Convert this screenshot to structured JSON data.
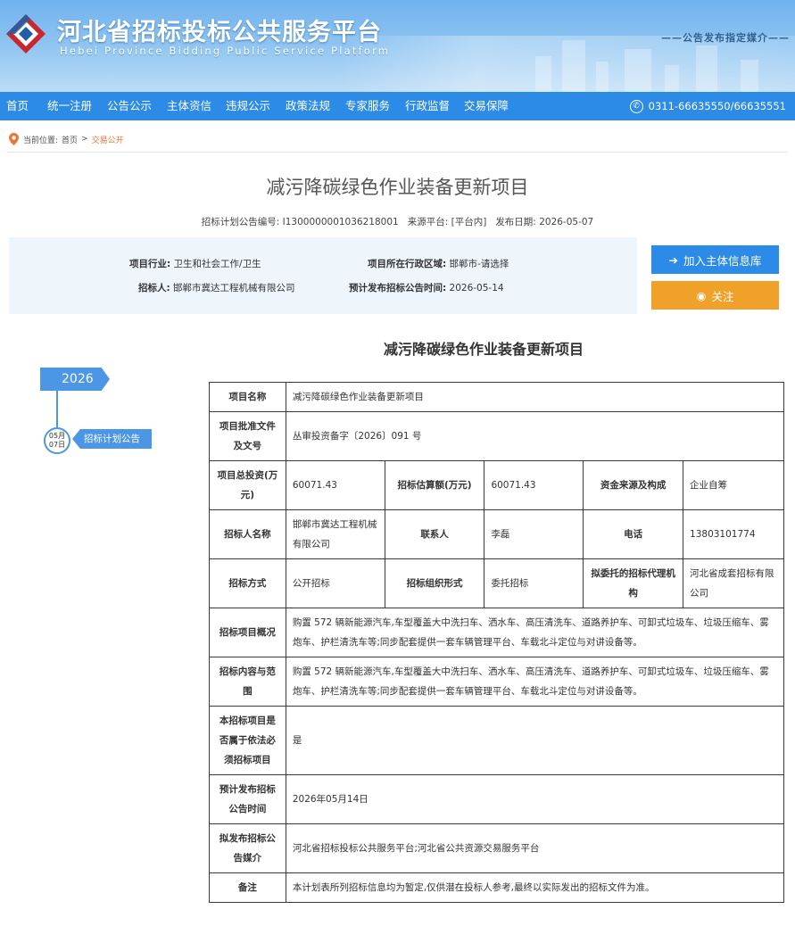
{
  "header": {
    "title": "河北省招标投标公共服务平台",
    "subtitle": "Hebei Province Bidding Public Service Platform",
    "media_note": "——公告发布指定媒介——"
  },
  "nav": {
    "items": [
      "首页",
      "统一注册",
      "公告公示",
      "主体资信",
      "违规公示",
      "政策法规",
      "专家服务",
      "行政监督",
      "交易保障"
    ],
    "phone": "0311-66635550/66635551"
  },
  "breadcrumb": {
    "prefix": "当前位置:",
    "home": "首页",
    "sep": ">",
    "current": "交易公开"
  },
  "page": {
    "title": "减污降碳绿色作业装备更新项目",
    "meta_code_label": "招标计划公告编号:",
    "meta_code": "I1300000001036218001",
    "meta_source_label": "来源平台:",
    "meta_source": "[平台内]",
    "meta_date_label": "发布日期:",
    "meta_date": "2026-05-07"
  },
  "info": {
    "industry_label": "项目行业:",
    "industry": "卫生和社会工作/卫生",
    "region_label": "项目所在行政区域:",
    "region": "邯郸市-请选择",
    "tenderer_label": "招标人:",
    "tenderer": "邯郸市冀达工程机械有限公司",
    "planned_date_label": "预计发布招标公告时间:",
    "planned_date": "2026-05-14"
  },
  "actions": {
    "add_label": "加入主体信息库",
    "follow_label": "关注"
  },
  "section_title": "减污降碳绿色作业装备更新项目",
  "timeline": {
    "year": "2026",
    "month": "05月",
    "day": "07日",
    "event": "招标计划公告"
  },
  "table": {
    "name_h": "项目名称",
    "name_v": "减污降碳绿色作业装备更新项目",
    "approval_h": "项目批准文件及文号",
    "approval_v": "丛审投资备字〔2026〕091 号",
    "invest_h": "项目总投资(万元)",
    "invest_v": "60071.43",
    "estimate_h": "招标估算额(万元)",
    "estimate_v": "60071.43",
    "fund_h": "资金来源及构成",
    "fund_v": "企业自筹",
    "tenderer_h": "招标人名称",
    "tenderer_v": "邯郸市冀达工程机械有限公司",
    "contact_h": "联系人",
    "contact_v": "李磊",
    "phone_h": "电话",
    "phone_v": "13803101774",
    "method_h": "招标方式",
    "method_v": "公开招标",
    "org_h": "招标组织形式",
    "org_v": "委托招标",
    "agency_h": "拟委托的招标代理机构",
    "agency_v": "河北省成套招标有限公司",
    "overview_h": "招标项目概况",
    "overview_v": "购置 572 辆新能源汽车,车型覆盖大中洗扫车、洒水车、高压清洗车、道路养护车、可卸式垃圾车、垃圾压缩车、雾炮车、护栏清洗车等;同步配套提供一套车辆管理平台、车载北斗定位与对讲设备等。",
    "scope_h": "招标内容与范围",
    "scope_v": "购置 572 辆新能源汽车,车型覆盖大中洗扫车、洒水车、高压清洗车、道路养护车、可卸式垃圾车、垃圾压缩车、雾炮车、护栏清洗车等;同步配套提供一套车辆管理平台、车载北斗定位与对讲设备等。",
    "legal_h": "本招标项目是否属于依法必须招标项目",
    "legal_v": "是",
    "plan_time_h": "预计发布招标公告时间",
    "plan_time_v": "2026年05月14日",
    "media_h": "拟发布招标公告媒介",
    "media_v": "河北省招标投标公共服务平台;河北省公共资源交易服务平台",
    "note_h": "备注",
    "note_v": "本计划表所列招标信息均为暂定,仅供潜在投标人参考,最终以实际发出的招标文件为准。"
  }
}
